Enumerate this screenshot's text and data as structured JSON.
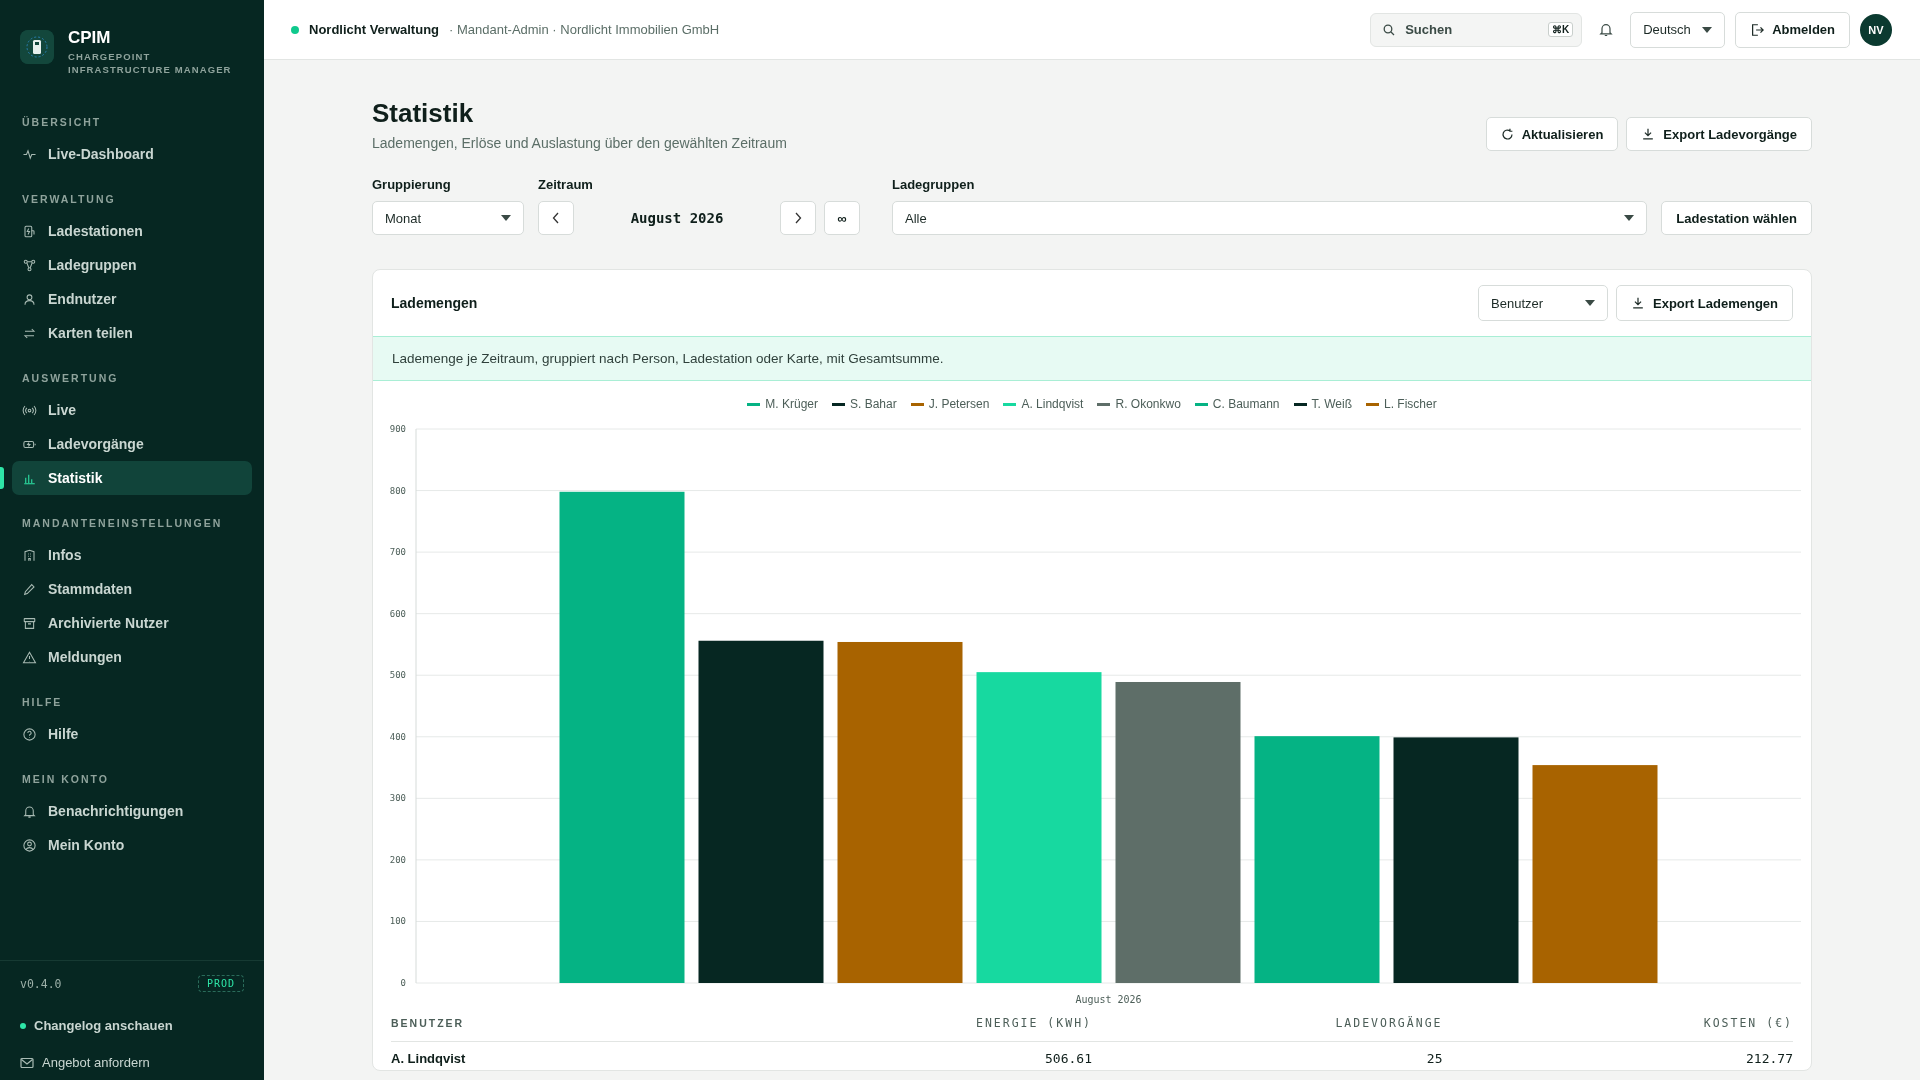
{
  "brand": {
    "title": "CPIM",
    "subtitle": "CHARGEPOINT INFRASTRUCTURE MANAGER"
  },
  "sidebar": {
    "sections": [
      {
        "heading": "ÜBERSICHT",
        "items": [
          {
            "label": "Live-Dashboard",
            "selected": false
          }
        ]
      },
      {
        "heading": "VERWALTUNG",
        "items": [
          {
            "label": "Ladestationen",
            "selected": false
          },
          {
            "label": "Ladegruppen",
            "selected": false
          },
          {
            "label": "Endnutzer",
            "selected": false
          },
          {
            "label": "Karten teilen",
            "selected": false
          }
        ]
      },
      {
        "heading": "AUSWERTUNG",
        "items": [
          {
            "label": "Live",
            "selected": false
          },
          {
            "label": "Ladevorgänge",
            "selected": false
          },
          {
            "label": "Statistik",
            "selected": true
          }
        ]
      },
      {
        "heading": "MANDANTENEINSTELLUNGEN",
        "items": [
          {
            "label": "Infos",
            "selected": false
          },
          {
            "label": "Stammdaten",
            "selected": false
          },
          {
            "label": "Archivierte Nutzer",
            "selected": false
          },
          {
            "label": "Meldungen",
            "selected": false
          }
        ]
      },
      {
        "heading": "HILFE",
        "items": [
          {
            "label": "Hilfe",
            "selected": false
          }
        ]
      },
      {
        "heading": "MEIN KONTO",
        "items": [
          {
            "label": "Benachrichtigungen",
            "selected": false
          },
          {
            "label": "Mein Konto",
            "selected": false
          }
        ]
      }
    ],
    "version": "v0.4.0",
    "env_badge": "PROD",
    "changelog_link": "Changelog anschauen",
    "offer_link": "Angebot anfordern"
  },
  "header": {
    "org": "Nordlicht Verwaltung",
    "context": "· Mandant-Admin · Nordlicht Immobilien GmbH",
    "search": {
      "placeholder": "Suchen",
      "shortcut": "⌘K"
    },
    "language": "Deutsch",
    "logout": "Abmelden",
    "avatar": "NV"
  },
  "page": {
    "title": "Statistik",
    "subtitle": "Lademengen, Erlöse und Auslastung über den gewählten Zeitraum",
    "buttons": [
      "Aktualisieren",
      "Export Ladevorgänge"
    ]
  },
  "filters": {
    "grouping": {
      "label": "Gruppierung",
      "value": "Monat"
    },
    "period": {
      "label": "Zeitraum",
      "value": "August 2026",
      "all": "∞"
    },
    "groups": {
      "label": "Ladegruppen",
      "value": "Alle"
    },
    "station_button": "Ladestation wählen"
  },
  "card": {
    "title": "Lademengen",
    "group_by": "Benutzer",
    "export": "Export Lademengen",
    "info": "Lademenge je Zeitraum, gruppiert nach Person, Ladestation oder Karte, mit Gesamtsumme.",
    "chart_data": {
      "type": "bar",
      "grid": true,
      "legend": true,
      "categories": [
        "August 2026"
      ],
      "ylim": [
        0,
        900
      ],
      "yticks": [
        0,
        100,
        200,
        300,
        400,
        500,
        600,
        700,
        800,
        900
      ],
      "series": [
        {
          "name": "M. Krüger",
          "color": "#05b384",
          "values": [
            798
          ]
        },
        {
          "name": "S. Bahar",
          "color": "#062722",
          "values": [
            556
          ]
        },
        {
          "name": "J. Petersen",
          "color": "#a86300",
          "values": [
            554
          ]
        },
        {
          "name": "A. Lindqvist",
          "color": "#17d9a0",
          "values": [
            505
          ]
        },
        {
          "name": "R. Okonkwo",
          "color": "#5e6e68",
          "values": [
            489
          ]
        },
        {
          "name": "C. Baumann",
          "color": "#05b384",
          "values": [
            401
          ]
        },
        {
          "name": "T. Weiß",
          "color": "#062722",
          "values": [
            399
          ]
        },
        {
          "name": "L. Fischer",
          "color": "#a86300",
          "values": [
            354
          ]
        }
      ]
    },
    "table": {
      "columns": [
        "BENUTZER",
        "ENERGIE (KWH)",
        "LADEVORGÄNGE",
        "KOSTEN (€)"
      ],
      "rows": [
        [
          "A. Lindqvist",
          "506.61",
          "25",
          "212.77"
        ]
      ]
    }
  }
}
